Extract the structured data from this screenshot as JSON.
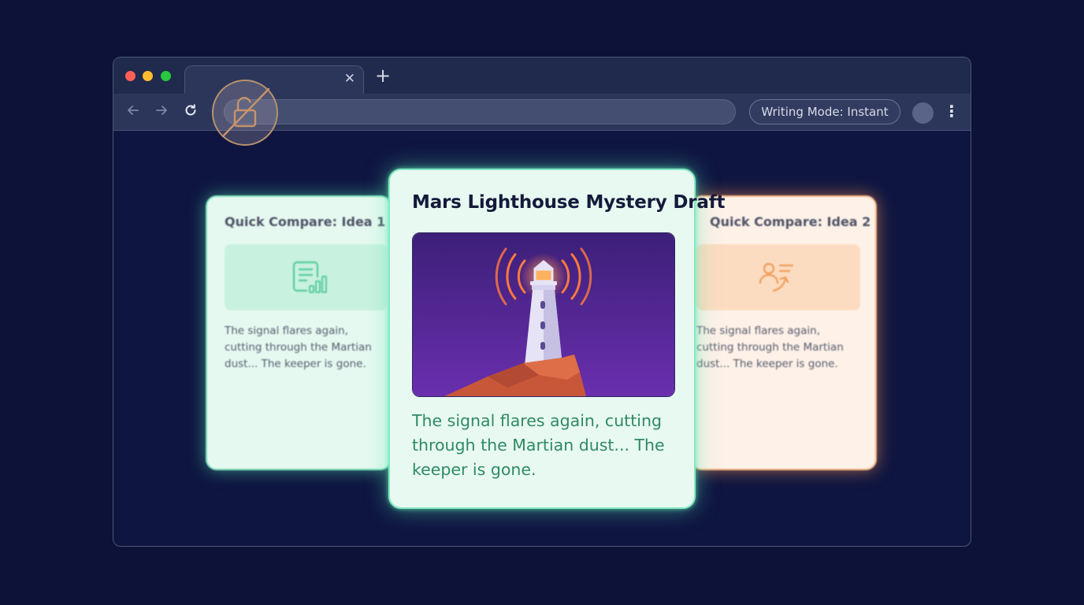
{
  "browser": {
    "tab": {
      "title": "",
      "close_icon": "close-icon"
    },
    "new_tab_icon": "plus-icon",
    "nav": {
      "back_icon": "arrow-left-icon",
      "forward_icon": "arrow-right-icon",
      "reload_icon": "reload-icon"
    },
    "address_bar": {
      "value": ""
    },
    "writing_mode": {
      "label": "Writing Mode:",
      "value": "Instant"
    },
    "menu_icon": "more-vertical-icon",
    "window_controls": {
      "close": "#ff5f57",
      "minimize": "#febc2e",
      "maximize": "#28c840"
    }
  },
  "lock_overlay": {
    "icon": "unlocked-padlock-crossed-icon"
  },
  "cards": {
    "left": {
      "title": "Quick Compare: Idea 1",
      "icon": "document-chart-icon",
      "text": "The signal flares again, cutting through the Martian dust... The keeper is gone."
    },
    "main": {
      "title": "Mars Lighthouse Mystery Draft",
      "image": "lighthouse-illustration",
      "text": "The signal flares again, cutting through the Martian dust... The keeper is gone."
    },
    "right": {
      "title": "Quick Compare: Idea 2",
      "icon": "person-list-arrow-icon",
      "text": "The signal flares again, cutting through the Martian dust... The keeper is gone."
    }
  },
  "colors": {
    "background": "#0c1238",
    "accent_green": "#86e8c2",
    "accent_orange": "#f3b585",
    "text_green": "#2f8a64"
  }
}
